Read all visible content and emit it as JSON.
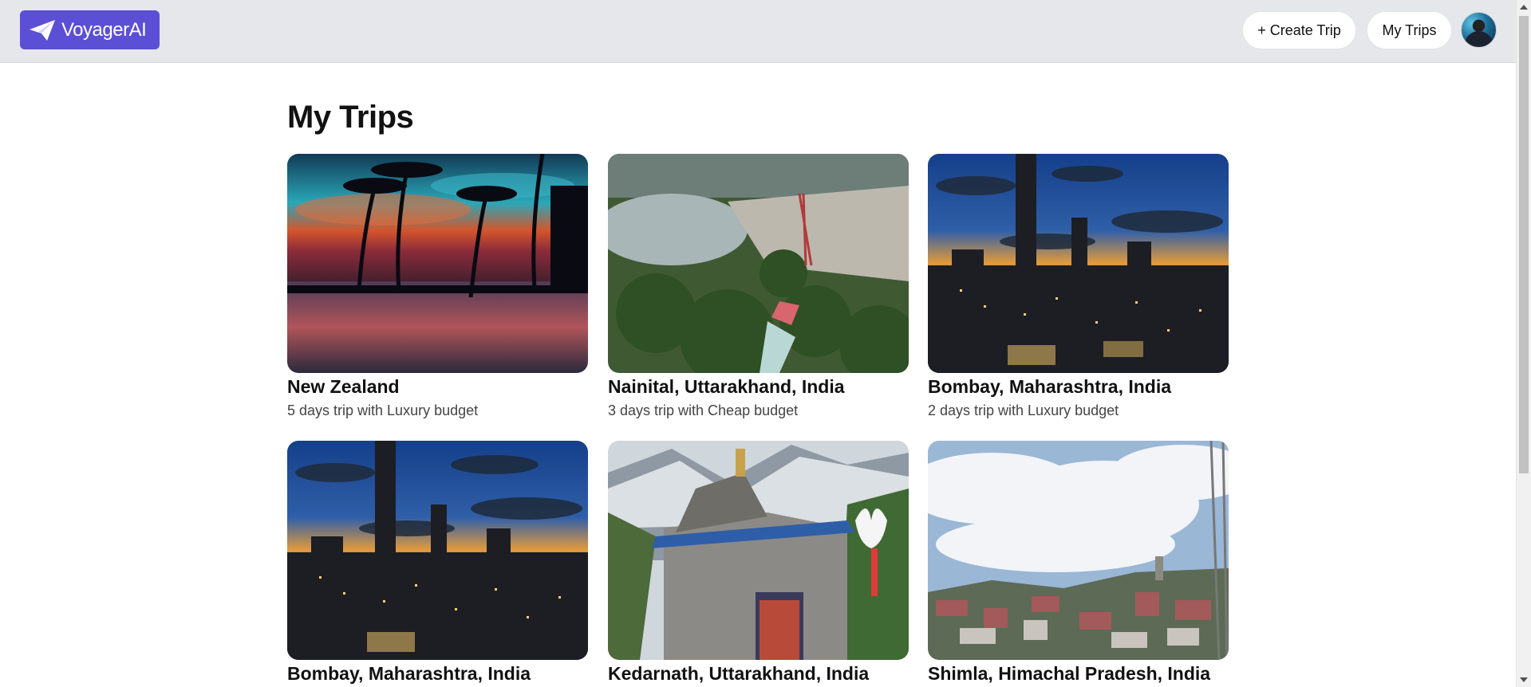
{
  "header": {
    "logo_text": "VoyagerAI",
    "create_trip_label": "+ Create Trip",
    "my_trips_label": "My Trips"
  },
  "page": {
    "title": "My Trips"
  },
  "trips": [
    {
      "name": "New Zealand",
      "details": "5 days trip with Luxury budget",
      "image": "tropical-sunset"
    },
    {
      "name": "Nainital, Uttarakhand, India",
      "details": "3 days trip with Cheap budget",
      "image": "hill-lake"
    },
    {
      "name": "Bombay, Maharashtra, India",
      "details": "2 days trip with Luxury budget",
      "image": "city-dusk"
    },
    {
      "name": "Bombay, Maharashtra, India",
      "details": "",
      "image": "city-dusk"
    },
    {
      "name": "Kedarnath, Uttarakhand, India",
      "details": "",
      "image": "temple-mountain"
    },
    {
      "name": "Shimla, Himachal Pradesh, India",
      "details": "",
      "image": "hill-town"
    }
  ],
  "colors": {
    "brand": "#5b4fd6",
    "header_bg": "#e5e7eb"
  }
}
